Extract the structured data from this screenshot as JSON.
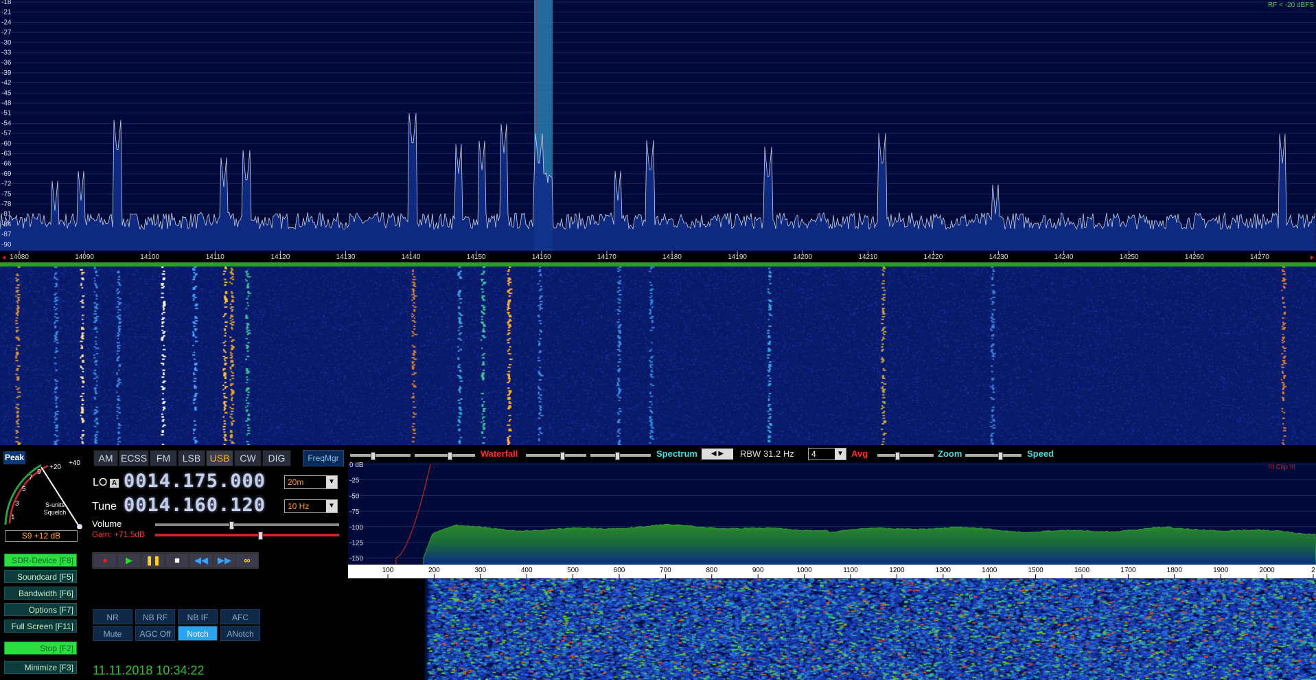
{
  "spectrum": {
    "db_labels": [
      "-18",
      "-21",
      "-24",
      "-27",
      "-30",
      "-33",
      "-36",
      "-39",
      "-42",
      "-45",
      "-48",
      "-51",
      "-54",
      "-57",
      "-60",
      "-63",
      "-66",
      "-69",
      "-72",
      "-75",
      "-78",
      "-81",
      "-84",
      "-87",
      "-90"
    ],
    "rf_label": "RF < -20 dBFS",
    "freq_labels": [
      "14080",
      "14090",
      "14100",
      "14110",
      "14120",
      "14130",
      "14140",
      "14150",
      "14160",
      "14170",
      "14180",
      "14190",
      "14200",
      "14210",
      "14220",
      "14230",
      "14240",
      "14250",
      "14260",
      "14270"
    ]
  },
  "modes": [
    "AM",
    "ECSS",
    "FM",
    "LSB",
    "USB",
    "CW",
    "DIG"
  ],
  "active_mode": "USB",
  "freqmgr_label": "FreqMgr",
  "peak_label": "Peak",
  "smeter": {
    "scale": [
      "1",
      "3",
      "5",
      "7",
      "9",
      "+20",
      "+40"
    ],
    "caption1": "S-units",
    "caption2": "Squelch",
    "reading": "S9 +12 dB"
  },
  "lo": {
    "label": "LO",
    "badge": "A",
    "value": "0014.175.000",
    "band": "20m"
  },
  "tune": {
    "label": "Tune",
    "value": "0014.160.120",
    "step": "10 Hz"
  },
  "volume_label": "Volume",
  "gain_label": "Gain: +71.5dB",
  "fkeys": [
    {
      "label": "SDR-Device [F8]",
      "green": true
    },
    {
      "label": "Soundcard [F5]",
      "green": false
    },
    {
      "label": "Bandwidth [F6]",
      "green": false
    },
    {
      "label": "Options [F7]",
      "green": false
    },
    {
      "label": "Full Screen [F11]",
      "green": false
    },
    {
      "label": "Stop [F2]",
      "green": true
    },
    {
      "label": "Minimize [F3]",
      "green": false
    }
  ],
  "dsp_row1": [
    "NR",
    "NB RF",
    "NB IF",
    "AFC"
  ],
  "dsp_row2": [
    "Mute",
    "AGC Off",
    "Notch",
    "ANotch"
  ],
  "dsp_active": "Notch",
  "datetime": "11.11.2018 10:34:22",
  "audio_toolbar": {
    "waterfall": "Waterfall",
    "spectrum": "Spectrum",
    "rbw": "RBW 31.2 Hz",
    "avg_value": "4",
    "avg": "Avg",
    "zoom": "Zoom",
    "speed": "Speed"
  },
  "audio_spectrum": {
    "db_labels": [
      "0 dB",
      "-25",
      "-50",
      "-75",
      "-100",
      "-125",
      "-150"
    ],
    "clip": "!!! Clip !!!",
    "freq_labels": [
      "100",
      "200",
      "300",
      "400",
      "500",
      "600",
      "700",
      "800",
      "900",
      "1000",
      "1100",
      "1200",
      "1300",
      "1400",
      "1500",
      "1600",
      "1700",
      "1800",
      "1900",
      "2000",
      "2"
    ]
  },
  "colors": {
    "spectrum_bg": "#000a3a",
    "marker": "#2a7ab0",
    "green_text": "#38d838",
    "accent_orange": "#ffb020",
    "cyan_text": "#44dddd",
    "red_text": "#ff2a2a"
  }
}
